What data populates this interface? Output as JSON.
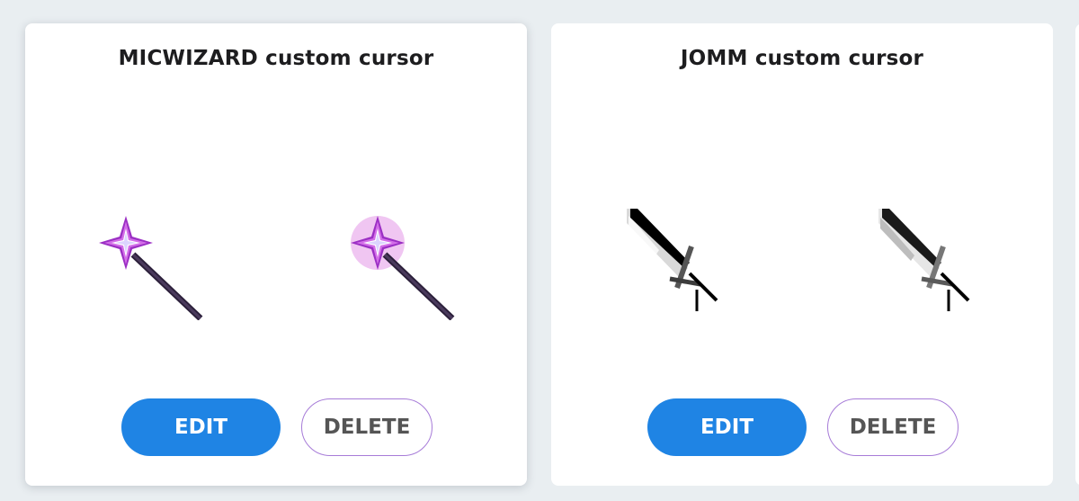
{
  "cards": [
    {
      "title": "MICWIZARD custom cursor",
      "cursor_icon": "magic-wand",
      "pointer_icon": "magic-wand-highlighted",
      "edit_label": "EDIT",
      "delete_label": "DELETE"
    },
    {
      "title": "JOMM custom cursor",
      "cursor_icon": "sword",
      "pointer_icon": "sword-faded",
      "edit_label": "EDIT",
      "delete_label": "DELETE"
    }
  ],
  "colors": {
    "page_background": "#e9eef1",
    "card_background": "#ffffff",
    "edit_button": "#1f84e4",
    "delete_border": "#a77cd8",
    "wand_star": "#b83fd6",
    "wand_stick": "#3a2a4a"
  }
}
